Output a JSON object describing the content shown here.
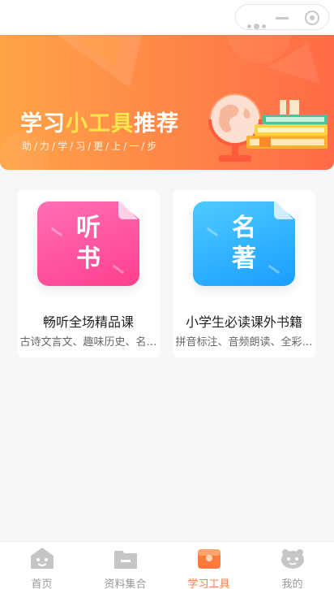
{
  "capsule": {
    "more_icon": "more-dots-icon",
    "minimize_icon": "minimize-icon",
    "close_icon": "target-circle-icon"
  },
  "banner": {
    "title_part1": "学习",
    "title_highlight": "小工具",
    "title_part2": "推荐",
    "subtitle": "助/力/学/习/更/上/一/步"
  },
  "cards": [
    {
      "icon_text_top": "听",
      "icon_text_bottom": "书",
      "title": "畅听全场精品课",
      "desc": "古诗文言文、趣味历史、名…",
      "color": "#ff4f9c"
    },
    {
      "icon_text_top": "名",
      "icon_text_bottom": "著",
      "title": "小学生必读课外书籍",
      "desc": "拼音标注、音频朗读、全彩…",
      "color": "#2aa9ff"
    }
  ],
  "tabbar": {
    "items": [
      {
        "label": "首页",
        "icon": "home-face-icon",
        "active": false
      },
      {
        "label": "资料集合",
        "icon": "folder-icon",
        "active": false
      },
      {
        "label": "学习工具",
        "icon": "toolbox-icon",
        "active": true
      },
      {
        "label": "我的",
        "icon": "profile-face-icon",
        "active": false
      }
    ],
    "active_color": "#ff7a3d",
    "inactive_color": "#999999"
  }
}
